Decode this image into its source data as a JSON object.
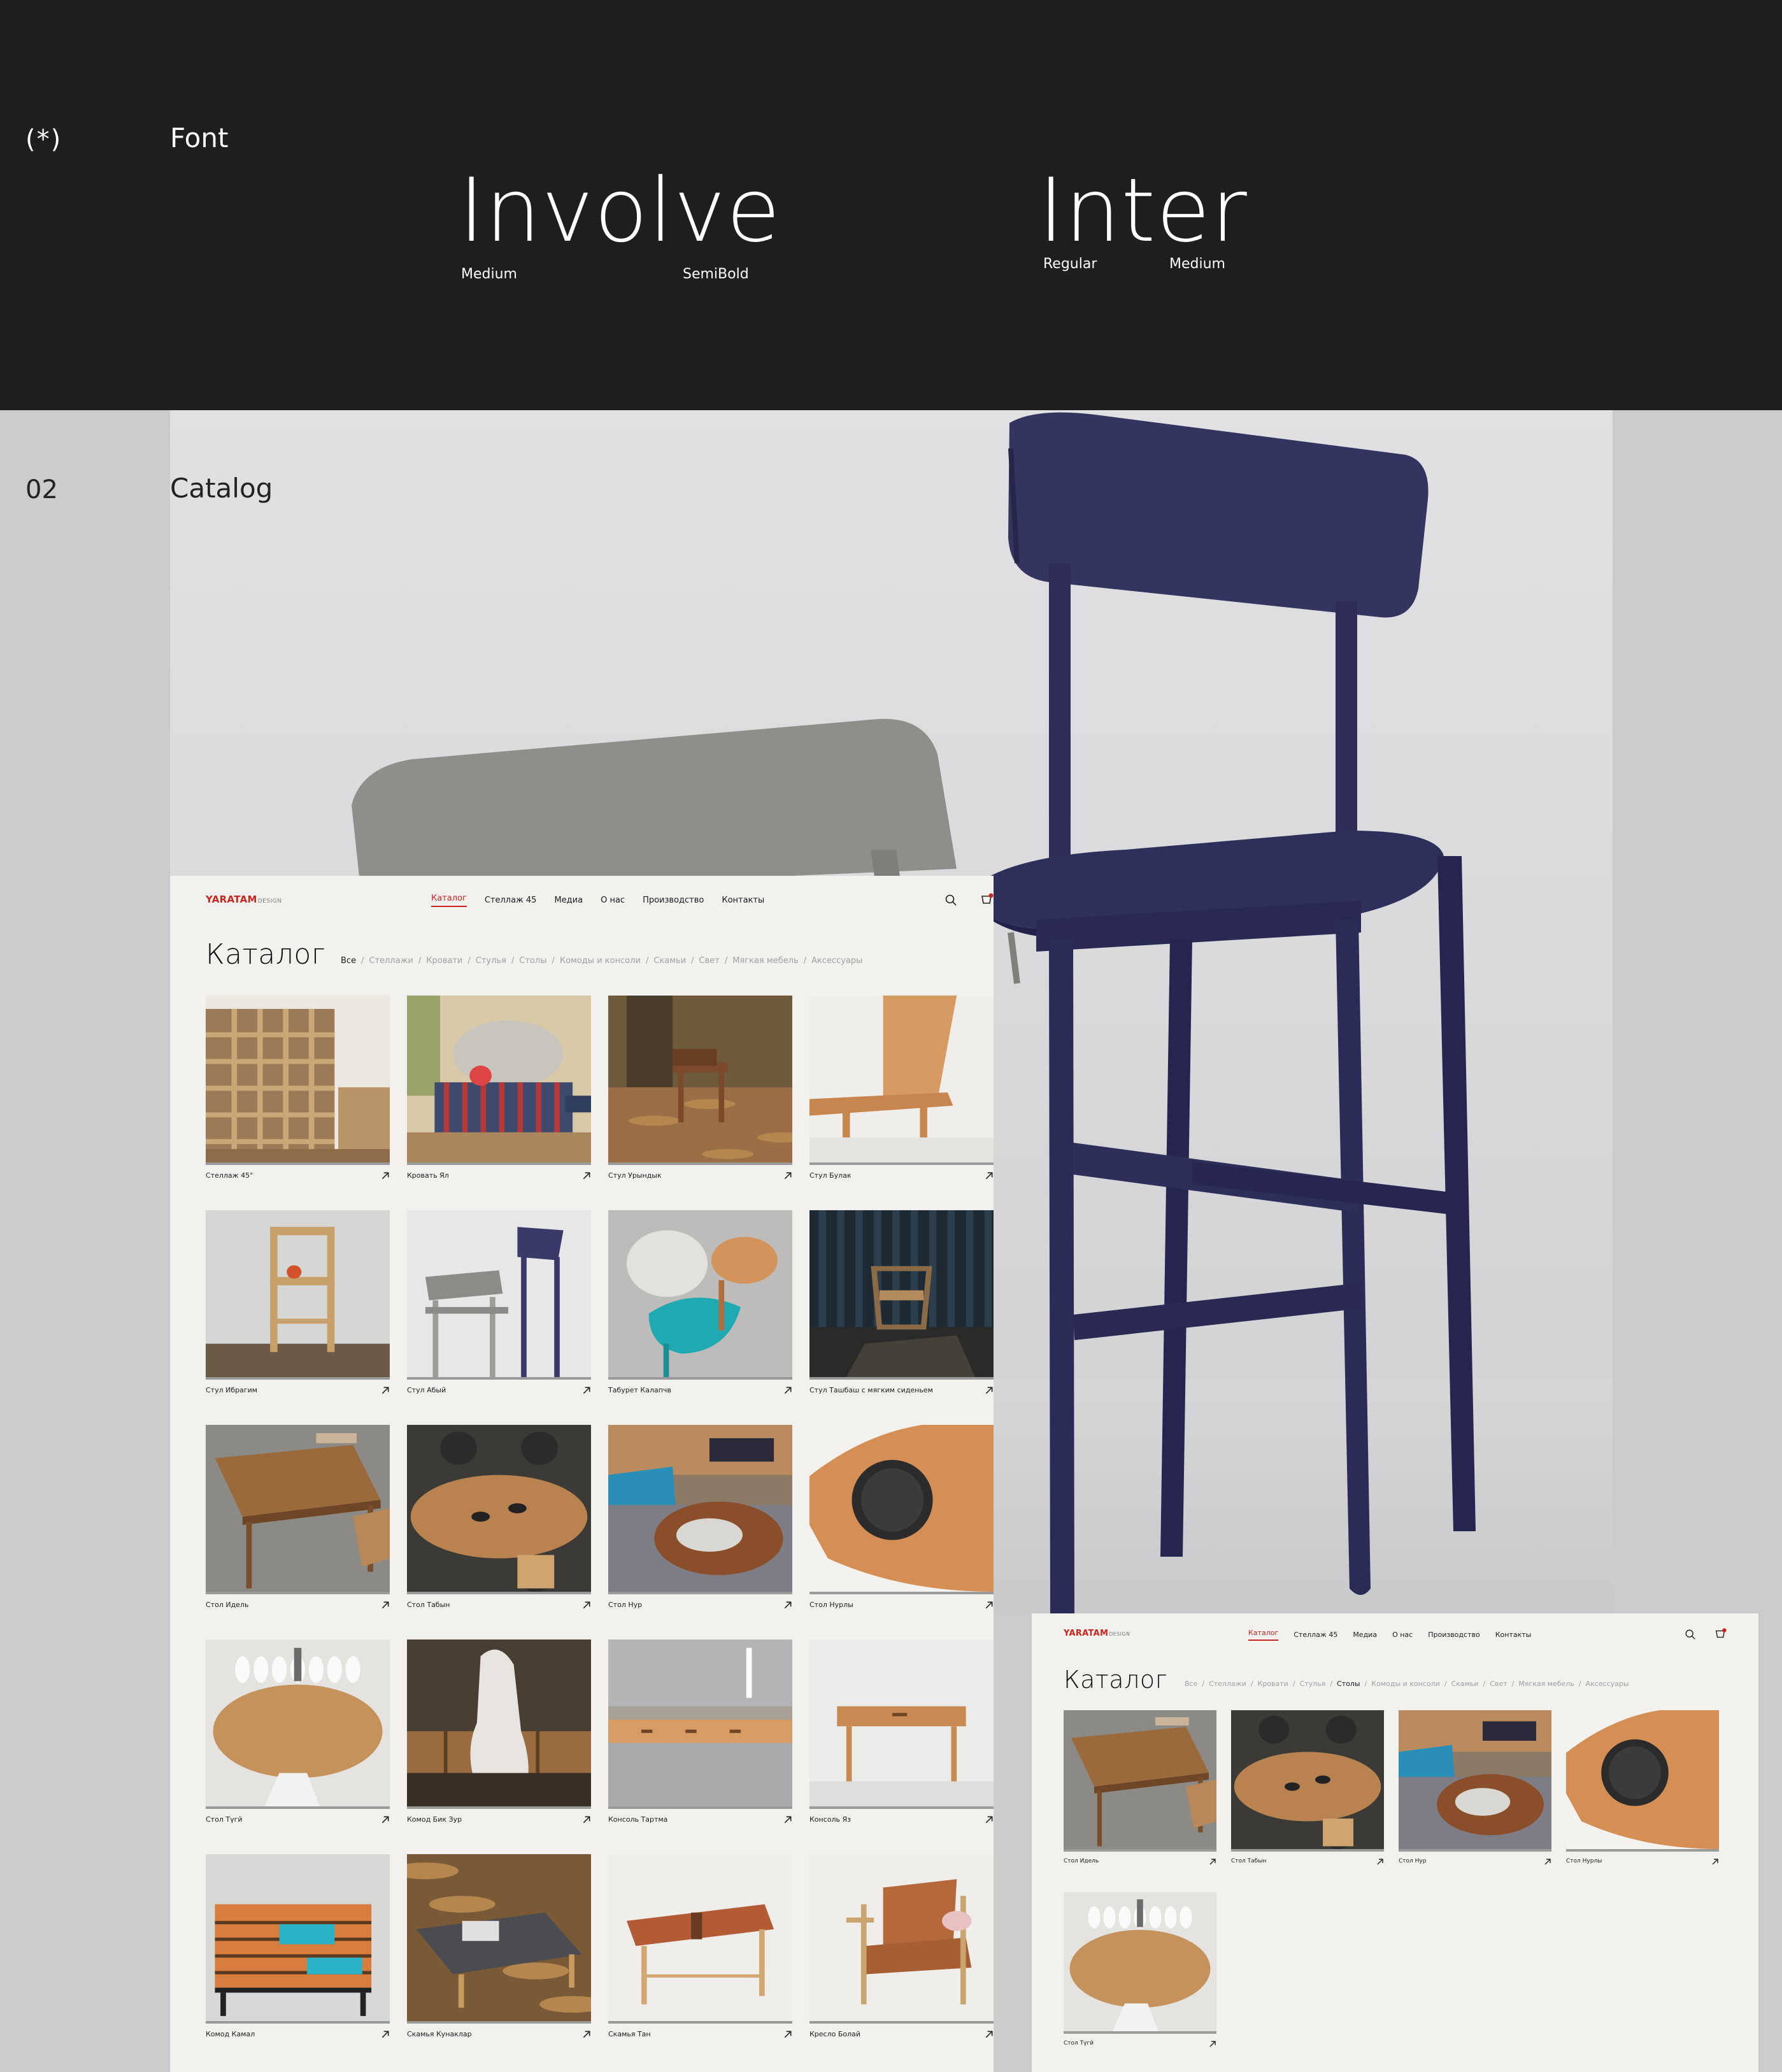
{
  "font_section": {
    "index": "(*)",
    "label": "Font",
    "fonts": [
      {
        "name": "Involve",
        "weights": [
          "Medium",
          "SemiBold"
        ]
      },
      {
        "name": "Inter",
        "weights": [
          "Regular",
          "Medium"
        ]
      }
    ]
  },
  "catalog_section": {
    "index": "02",
    "label": "Catalog"
  },
  "site": {
    "logo": "YARATAM",
    "logo_suffix": "DESIGN",
    "nav": [
      "Каталог",
      "Стеллаж 45",
      "Медиа",
      "О нас",
      "Производство",
      "Контакты"
    ],
    "active_nav": "Каталог",
    "icons": [
      "search-icon",
      "cart-icon"
    ],
    "accent_color": "#c8251e",
    "page_title": "Каталог",
    "filters": [
      "Все",
      "Стеллажи",
      "Кровати",
      "Стулья",
      "Столы",
      "Комоды и консоли",
      "Скамьи",
      "Свет",
      "Мягкая мебель",
      "Аксессуары"
    ]
  },
  "catalog_page": {
    "active_filter": "Все",
    "products": [
      {
        "name": "Стеллаж 45°"
      },
      {
        "name": "Кровать Ял"
      },
      {
        "name": "Стул Урындык"
      },
      {
        "name": "Стул Булак"
      },
      {
        "name": "Стул Ибрагим"
      },
      {
        "name": "Стул Абый"
      },
      {
        "name": "Табурет Калапчв"
      },
      {
        "name": "Стул Ташбаш с мягким сиденьем"
      },
      {
        "name": "Стол Идель"
      },
      {
        "name": "Стол Табын"
      },
      {
        "name": "Стол Нур"
      },
      {
        "name": "Стол Нурлы"
      },
      {
        "name": "Стол Түгй"
      },
      {
        "name": "Комод Бик Зур"
      },
      {
        "name": "Консоль Тартма"
      },
      {
        "name": "Консоль Яз"
      },
      {
        "name": "Комод Камал"
      },
      {
        "name": "Скамья Кунаклар"
      },
      {
        "name": "Скамья Тан"
      },
      {
        "name": "Кресло Болай"
      }
    ]
  },
  "tables_page": {
    "active_filter": "Столы",
    "products": [
      {
        "name": "Стол Идель"
      },
      {
        "name": "Стол Табын"
      },
      {
        "name": "Стол Нур"
      },
      {
        "name": "Стол Нурлы"
      },
      {
        "name": "Стол Түгй"
      }
    ]
  }
}
